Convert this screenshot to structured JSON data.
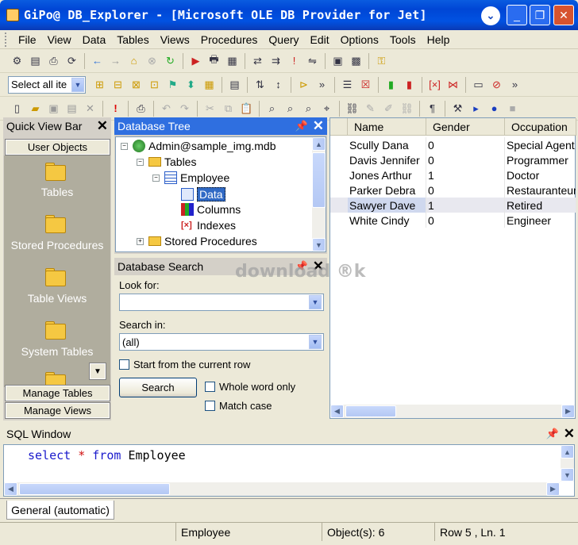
{
  "window": {
    "title": "GiPo@ DB_Explorer - [Microsoft OLE DB Provider for Jet]",
    "minimize": "_",
    "restore": "❐",
    "close": "✕",
    "ribbon_toggle": "⌄"
  },
  "menu": [
    "File",
    "View",
    "Data",
    "Tables",
    "Views",
    "Procedures",
    "Query",
    "Edit",
    "Options",
    "Tools",
    "Help"
  ],
  "toolbar2": {
    "select_all": "Select all ite"
  },
  "quick_view": {
    "title": "Quick View Bar",
    "top_button": "User Objects",
    "items": [
      {
        "label": "Tables",
        "icon": "folder-table-icon"
      },
      {
        "label": "Stored Procedures",
        "icon": "folder-procedure-icon"
      },
      {
        "label": "Table Views",
        "icon": "folder-view-icon"
      },
      {
        "label": "System Tables",
        "icon": "folder-system-icon"
      }
    ],
    "manage_tables": "Manage Tables",
    "manage_views": "Manage Views"
  },
  "db_tree": {
    "title": "Database Tree",
    "root": "Admin@sample_img.mdb",
    "tables": "Tables",
    "employee": "Employee",
    "data": "Data",
    "columns": "Columns",
    "indexes": "Indexes",
    "stored_procedures": "Stored Procedures"
  },
  "db_search": {
    "title": "Database Search",
    "look_for_label": "Look for:",
    "look_for_value": "",
    "search_in_label": "Search in:",
    "search_in_value": "(all)",
    "start_current": "Start from the current row",
    "search_button": "Search",
    "whole_word": "Whole word only",
    "match_case": "Match case"
  },
  "grid": {
    "columns": [
      "Name",
      "Gender",
      "Occupation"
    ],
    "rows": [
      [
        "Scully Dana",
        "0",
        "Special Agent"
      ],
      [
        "Davis Jennifer",
        "0",
        "Programmer"
      ],
      [
        "Jones Arthur",
        "1",
        "Doctor"
      ],
      [
        "Parker Debra",
        "0",
        "Restauranteur"
      ],
      [
        "Sawyer Dave",
        "1",
        "Retired"
      ],
      [
        "White Cindy",
        "0",
        "Engineer"
      ]
    ],
    "selected_row": 4
  },
  "sql_window": {
    "title": "SQL Window",
    "kw_select": "select",
    "op_star": "*",
    "kw_from": "from",
    "table": "Employee"
  },
  "tab": {
    "label": "General (automatic)"
  },
  "status": {
    "table": "Employee",
    "objects": "Object(s): 6",
    "position": "Row 5 , Ln. 1"
  },
  "watermark": "download ®k",
  "colors": {
    "title_blue": "#0046d5",
    "panel_title_active": "#2f6fe0",
    "quickview_bg": "#b0ad9e",
    "sql_keyword": "#1a1acc"
  }
}
